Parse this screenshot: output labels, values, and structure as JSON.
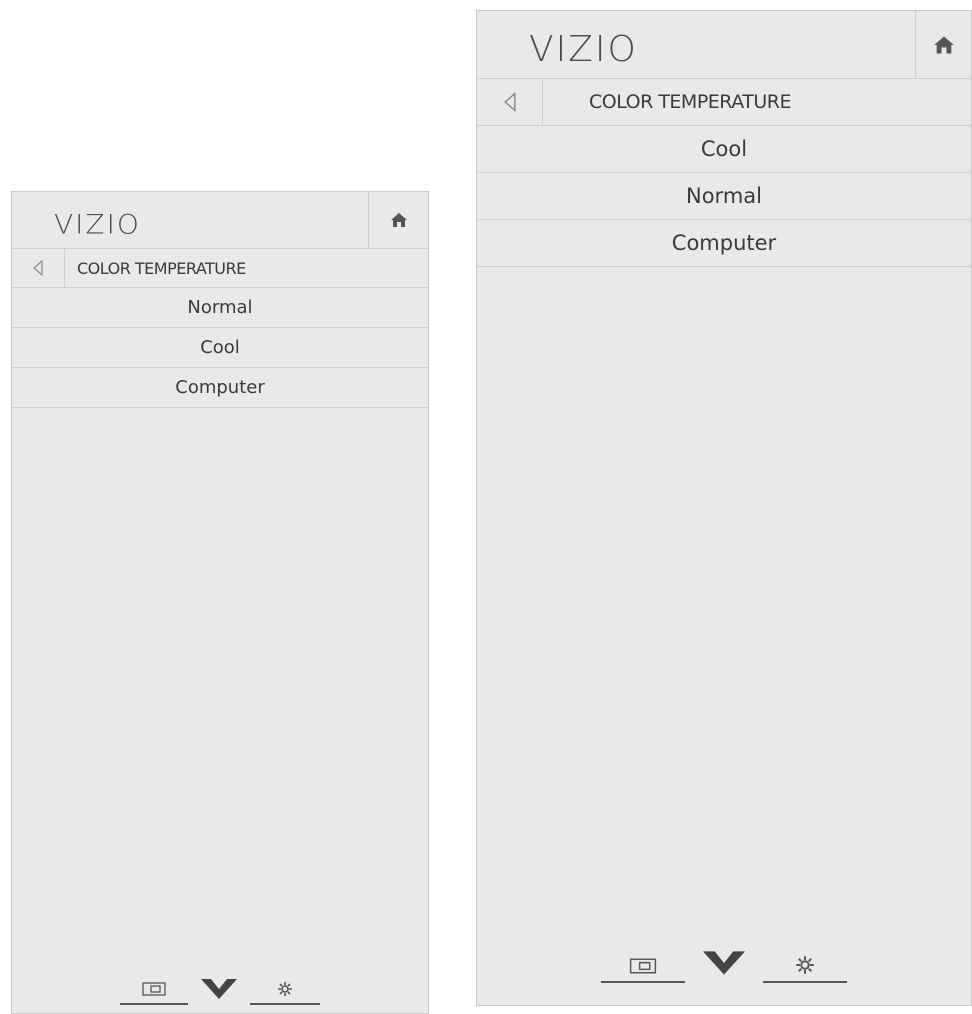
{
  "panels": [
    {
      "logo": "VIZIO",
      "title": "COLOR TEMPERATURE",
      "options": [
        "Normal",
        "Cool",
        "Computer"
      ]
    },
    {
      "logo": "VIZIO",
      "title": "COLOR TEMPERATURE",
      "options": [
        "Cool",
        "Normal",
        "Computer"
      ]
    }
  ],
  "icons": {
    "home": "home-icon",
    "back": "back-arrow-icon",
    "input": "input-icon",
    "vizio_v": "vizio-v-icon",
    "settings": "gear-icon"
  },
  "colors": {
    "panel_bg": "#e9e9e9",
    "divider": "#cfcfcf",
    "text": "#3a3a3a",
    "icon": "#555555"
  }
}
